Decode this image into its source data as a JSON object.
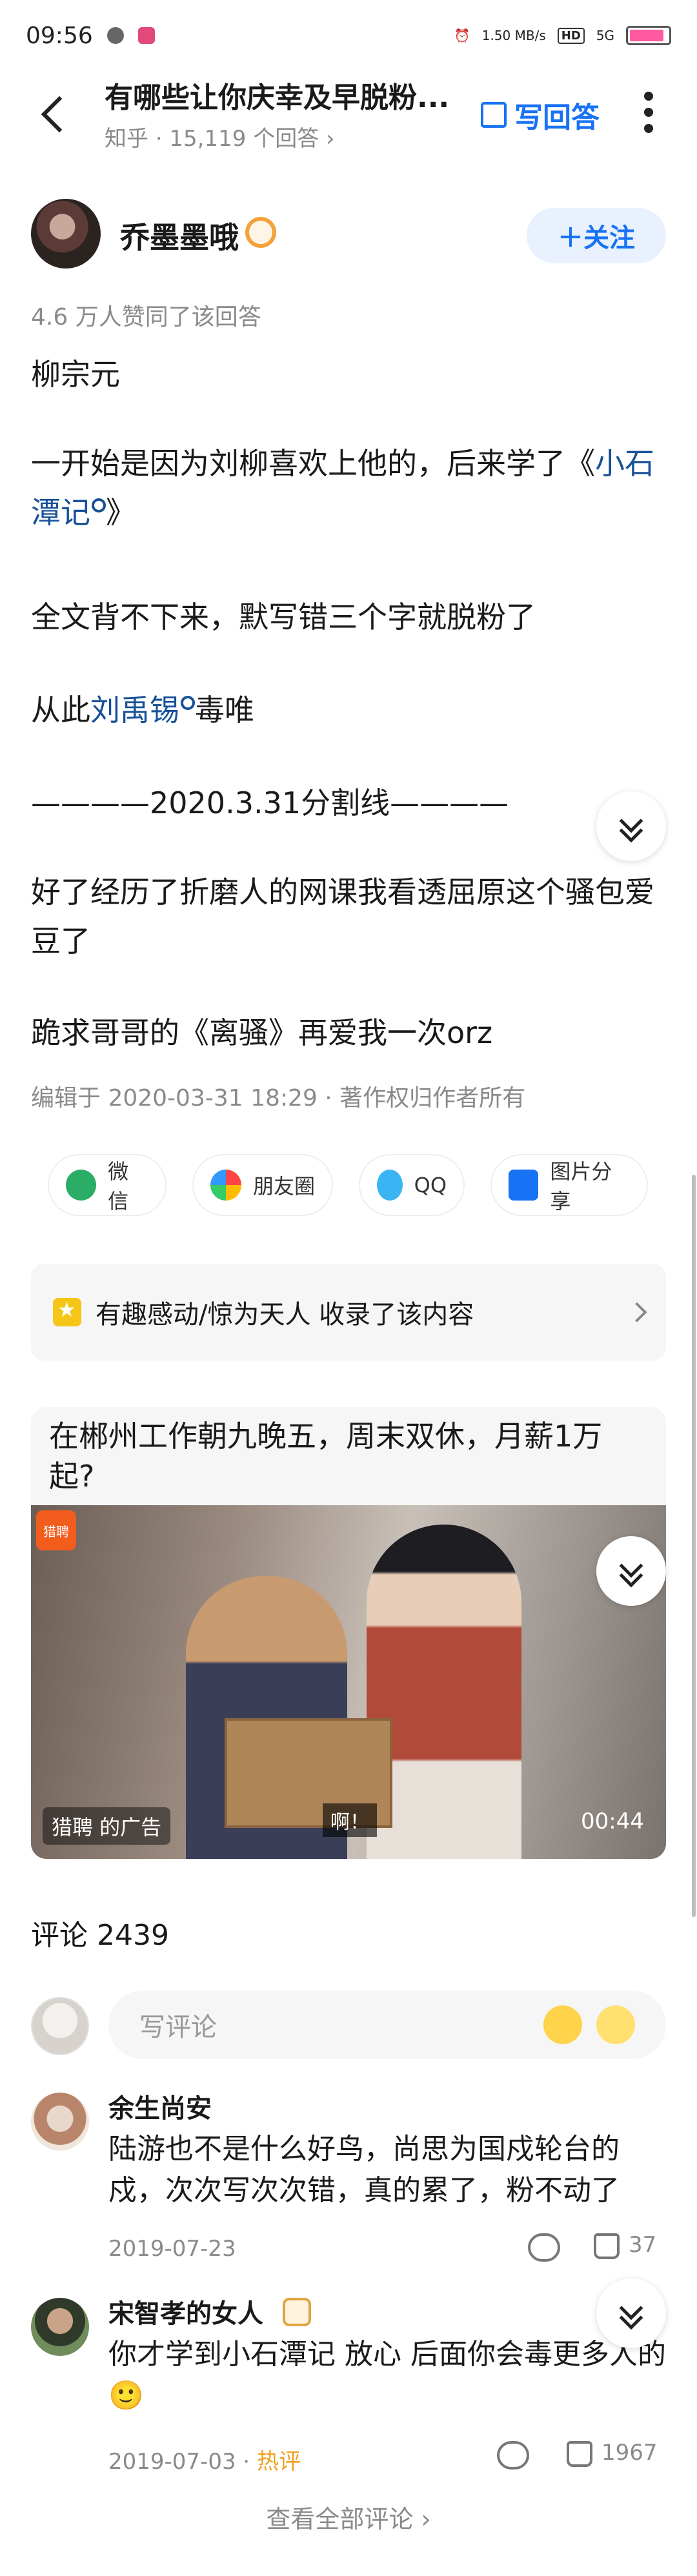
{
  "status": {
    "time": "09:56",
    "net_speed": "1.50 MB/s",
    "hd": "HD",
    "signal": "5G"
  },
  "header": {
    "title": "有哪些让你庆幸及早脱粉...",
    "subtitle": "知乎 · 15,119 个回答 ›",
    "write_answer": "写回答"
  },
  "author": {
    "name": "乔墨墨哦",
    "follow": "＋关注",
    "votes": "4.6 万人赞同了该回答"
  },
  "content": {
    "p1": "柳宗元",
    "p2_a": "一开始是因为刘柳喜欢上他的，后来学了《",
    "p2_link": "小石潭记",
    "p2_b": "》",
    "p3": "全文背不下来，默写错三个字就脱粉了",
    "p4_a": "从此",
    "p4_link": "刘禹锡",
    "p4_b": "毒唯",
    "p5": "————2020.3.31分割线————",
    "p6": "好了经历了折磨人的网课我看透屈原这个骚包爱豆了",
    "p7": "跪求哥哥的《离骚》再爱我一次orz",
    "edited": "编辑于 2020-03-31 18:29 · 著作权归作者所有"
  },
  "share": {
    "wechat": "微信",
    "moments": "朋友圈",
    "qq": "QQ",
    "image": "图片分享"
  },
  "collection": "有趣感动/惊为天人 收录了该内容",
  "ad": {
    "title": "在郴州工作朝九晚五，周末双休，月薪1万起?",
    "logo": "猎聘",
    "label": "猎聘 的广告",
    "subtitle": "啊！",
    "duration": "00:44"
  },
  "comments": {
    "title": "评论 2439",
    "placeholder": "写评论",
    "items": [
      {
        "name": "余生尚安",
        "text": "陆游也不是什么好鸟，尚思为国戍轮台的戍，次次写次次错，真的累了，粉不动了",
        "date": "2019-07-23",
        "likes": "37"
      },
      {
        "name": "宋智孝的女人",
        "text": "你才学到小石潭记 放心 后面你会毒更多人的🙂",
        "date": "2019-07-03 · ",
        "hot": "热评",
        "likes": "1967"
      }
    ],
    "see_all": "查看全部评论 ›"
  },
  "colors": {
    "accent": "#1772f6",
    "link": "#175199",
    "muted": "#8a8a8a"
  }
}
